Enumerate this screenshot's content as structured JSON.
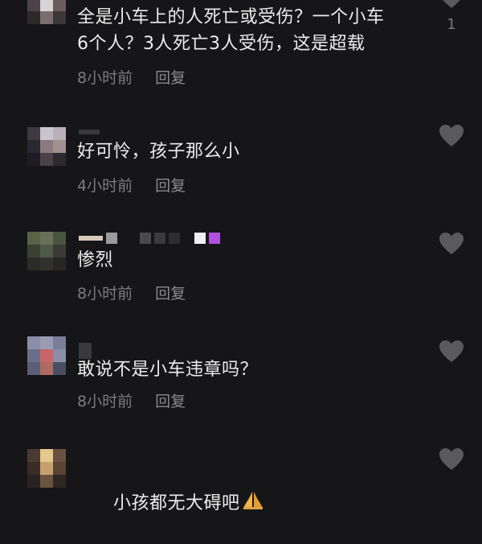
{
  "comments": [
    {
      "text_line1": "全是小车上的人死亡或受伤？一个小车",
      "text_line2": "6个人？3人死亡3人受伤，这是超载",
      "time": "8小时前",
      "reply": "回复",
      "likes": "1",
      "heart_icon": "heart-icon"
    },
    {
      "text_line1": "好可怜，孩子那么小",
      "time": "4小时前",
      "reply": "回复",
      "heart_icon": "heart-icon"
    },
    {
      "text_line1": "惨烈",
      "time": "8小时前",
      "reply": "回复",
      "heart_icon": "heart-icon"
    },
    {
      "text_line1": "敢说不是小车违章吗？",
      "time": "8小时前",
      "reply": "回复",
      "heart_icon": "heart-icon"
    },
    {
      "text_line1": "小孩都无大碍吧",
      "emoji": "🙏",
      "heart_icon": "heart-icon"
    }
  ],
  "colors": {
    "background": "#161618",
    "text": "#ececec",
    "meta": "#7c7c80",
    "heart": "#5a5a5e"
  }
}
